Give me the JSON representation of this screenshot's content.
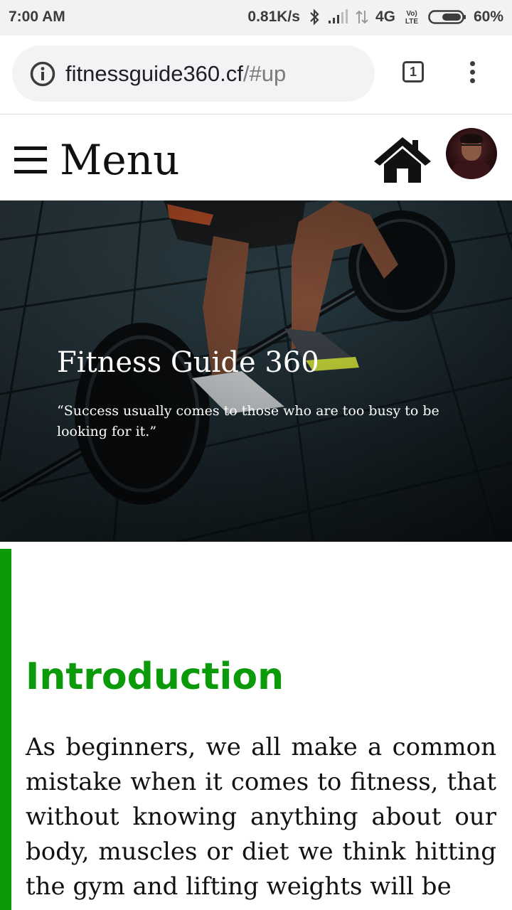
{
  "status_bar": {
    "time": "7:00 AM",
    "net_speed": "0.81K/s",
    "network_type": "4G",
    "volte": "Vo LTE",
    "battery": "60%"
  },
  "browser": {
    "url_host": "fitnessguide360.cf",
    "url_fragment": "/#up",
    "tab_count": "1"
  },
  "site_nav": {
    "menu_label": "Menu"
  },
  "hero": {
    "title": "Fitness Guide 360",
    "quote": "“Success usually comes to those who are too busy to be looking for it.”"
  },
  "content": {
    "heading": "Introduction",
    "body": "As beginners, we all make a common mistake when it comes to fitness, that without knowing anything about our body, muscles or diet we think hitting the gym and lifting weights will be"
  },
  "colors": {
    "accent_green": "#0a9a0a",
    "status_bar_bg": "#f2f2f2",
    "url_box_bg": "#f1f3f4"
  }
}
